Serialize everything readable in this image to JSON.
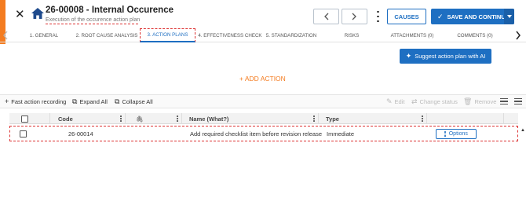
{
  "header": {
    "title": "26-00008 - Internal Occurence",
    "subtitle": "Execution of the occurence action plan",
    "causes_label": "CAUSES",
    "save_label": "SAVE AND CONTINUE"
  },
  "tabs": [
    {
      "label": "1. GENERAL",
      "active": false
    },
    {
      "label": "2. ROOT CAUSE ANALYSIS",
      "active": false
    },
    {
      "label": "3. ACTION PLANS",
      "active": true
    },
    {
      "label": "4. EFFECTIVENESS CHECK",
      "active": false
    },
    {
      "label": "5. STANDARDIZATION",
      "active": false
    },
    {
      "label": "RISKS",
      "active": false
    },
    {
      "label": "ATTACHMENTS (0)",
      "active": false
    },
    {
      "label": "COMMENTS (0)",
      "active": false
    }
  ],
  "ai_button": {
    "label": "Suggest action plan with AI",
    "icon": "sparkle-icon"
  },
  "add_action": {
    "label": "+ ADD ACTION"
  },
  "toolbar": {
    "fast_recording": "Fast action recording",
    "expand_all": "Expand All",
    "collapse_all": "Collapse All",
    "edit": "Edit",
    "change_status": "Change status",
    "remove": "Remove"
  },
  "table": {
    "columns": [
      "Code",
      "",
      "Name (What?)",
      "Type"
    ],
    "rows": [
      {
        "code": "26-00014",
        "name": "Add required checklist item before revision release",
        "type": "Immediate",
        "options_label": "Options"
      }
    ]
  },
  "colors": {
    "accent": "#f47c20",
    "primary": "#1e6fc2",
    "highlight": "#dd3333"
  }
}
